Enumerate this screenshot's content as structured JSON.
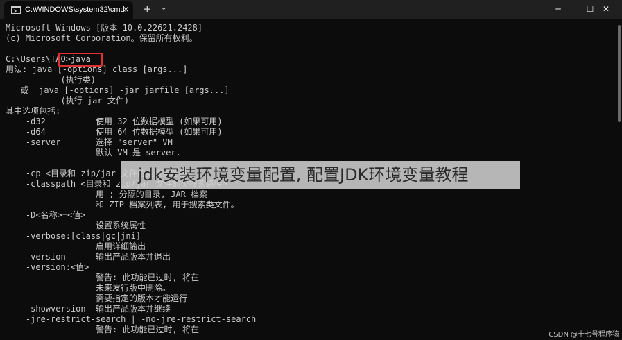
{
  "titlebar": {
    "tab_title": "C:\\WINDOWS\\system32\\cmd.",
    "tab_close": "✕",
    "new_tab": "+",
    "dropdown": "⌄",
    "minimize": "─",
    "maximize": "☐",
    "close": "✕"
  },
  "terminal": {
    "lines": [
      "Microsoft Windows [版本 10.0.22621.2428]",
      "(c) Microsoft Corporation。保留所有权利。",
      "",
      "C:\\Users\\TAO>java",
      "用法: java [-options] class [args...]",
      "           (执行类)",
      "   或  java [-options] -jar jarfile [args...]",
      "           (执行 jar 文件)",
      "其中选项包括:",
      "    -d32          使用 32 位数据模型 (如果可用)",
      "    -d64          使用 64 位数据模型 (如果可用)",
      "    -server       选择 \"server\" VM",
      "                  默认 VM 是 server.",
      "",
      "    -cp <目录和 zip/jar 文件的类搜索路径>",
      "    -classpath <目录和 zip/jar 文件的类搜索路径>",
      "                  用 ; 分隔的目录, JAR 档案",
      "                  和 ZIP 档案列表, 用于搜索类文件。",
      "    -D<名称>=<值>",
      "                  设置系统属性",
      "    -verbose:[class|gc|jni]",
      "                  启用详细输出",
      "    -version      输出产品版本并退出",
      "    -version:<值>",
      "                  警告: 此功能已过时, 将在",
      "                  未来发行版中删除。",
      "                  需要指定的版本才能运行",
      "    -showversion  输出产品版本并继续",
      "    -jre-restrict-search | -no-jre-restrict-search",
      "                  警告: 此功能已过时, 将在"
    ]
  },
  "overlay": {
    "caption": "jdk安装环境变量配置, 配置JDK环境变量教程"
  },
  "watermark": "CSDN @十七号程序猿",
  "colors": {
    "terminal_bg": "#0c0c0c",
    "terminal_text": "#cccccc",
    "titlebar_bg": "#202020",
    "highlight_border": "#e03131"
  }
}
